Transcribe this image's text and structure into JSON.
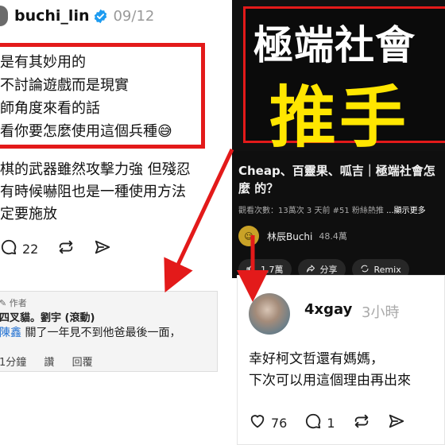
{
  "left_post": {
    "username": "buchi_lin",
    "date": "09/12",
    "boxed_lines": [
      "是有其妙用的",
      "不討論遊戲而是現實",
      "師角度來看的話",
      "看你要怎麼使用這個兵種😅"
    ],
    "more_lines": [
      "棋的武器雖然攻擊力強 但殘忍",
      "有時候嚇阻也是一種使用方法",
      "定要施放"
    ],
    "actions": {
      "reply_count": "22"
    },
    "comment": {
      "author_tag": "作者",
      "name": "四叉貓。劉宇 (滾動)",
      "mention": "陳鑫",
      "text": " 關了一年見不到他爸最後一面，",
      "time": "1分鐘",
      "read": "讚",
      "reply": "回覆"
    }
  },
  "youtube": {
    "thumb_title": "極端社會",
    "thumb_yellow": "推手",
    "title": "Cheap、百靈果、呱吉｜極端社會怎麼 的？",
    "meta": "觀看次數：13萬次  3 天前  #51 粉絲熱推",
    "more": "...顯示更多",
    "channel_name": "林辰Buchi",
    "channel_subs": "48.4萬",
    "likes": "1.7萬",
    "share": "分享",
    "remix": "Remix"
  },
  "reply": {
    "username": "4xgay",
    "time": "3小時",
    "lines": [
      "幸好柯文哲還有媽媽，",
      "下次可以用這個理由再出來"
    ],
    "like_count": "76",
    "comment_count": "1"
  },
  "colors": {
    "red_annotation": "#e31a1a",
    "yt_yellow": "#ffe600",
    "verified_blue": "#1d9bf0"
  }
}
